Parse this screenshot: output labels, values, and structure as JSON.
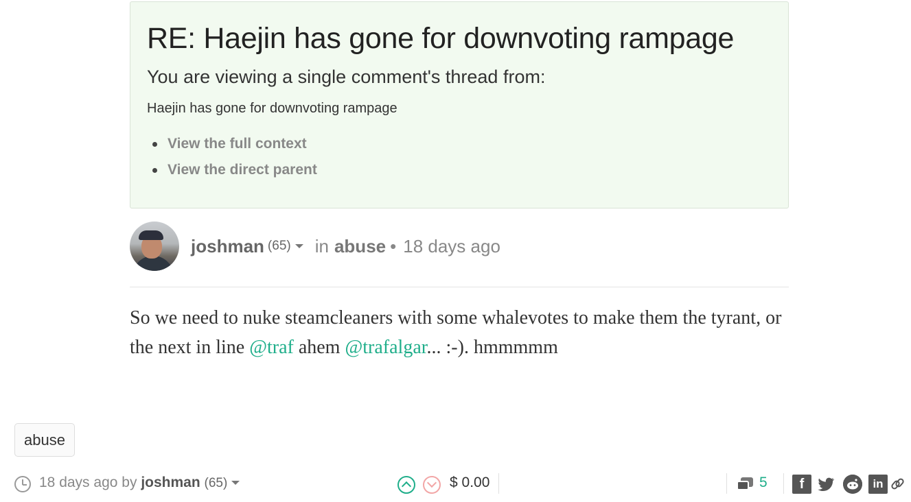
{
  "context": {
    "title": "RE: Haejin has gone for downvoting rampage",
    "subtitle": "You are viewing a single comment's thread from:",
    "parent_title": "Haejin has gone for downvoting rampage",
    "links": [
      "View the full context",
      "View the direct parent"
    ]
  },
  "post": {
    "author": "joshman",
    "reputation": "(65)",
    "in_label": "in",
    "category": "abuse",
    "separator": "•",
    "time_ago": "18 days ago",
    "body": {
      "part1": "So we need to nuke steamcleaners with some whalevotes to make them the tyrant, or the next in line ",
      "mention1": "@traf",
      "part2": " ahem ",
      "mention2": "@trafalgar",
      "part3": "... :-). hmmmmm"
    }
  },
  "tags": [
    "abuse"
  ],
  "footer": {
    "time_ago": "18 days ago",
    "by_label": "by",
    "author": "joshman",
    "reputation": "(65)",
    "payout": "$ 0.00",
    "comment_count": "5"
  },
  "icons": {
    "clock": "clock-icon",
    "upvote": "chevron-up-circle-icon",
    "downvote": "chevron-down-circle-icon",
    "comments": "comments-icon",
    "facebook": "facebook-icon",
    "twitter": "twitter-icon",
    "reddit": "reddit-icon",
    "linkedin": "linkedin-icon",
    "link": "link-icon"
  },
  "colors": {
    "accent": "#1fae8a",
    "downvote": "#f2a6a6",
    "context_bg": "#f2faf0"
  }
}
